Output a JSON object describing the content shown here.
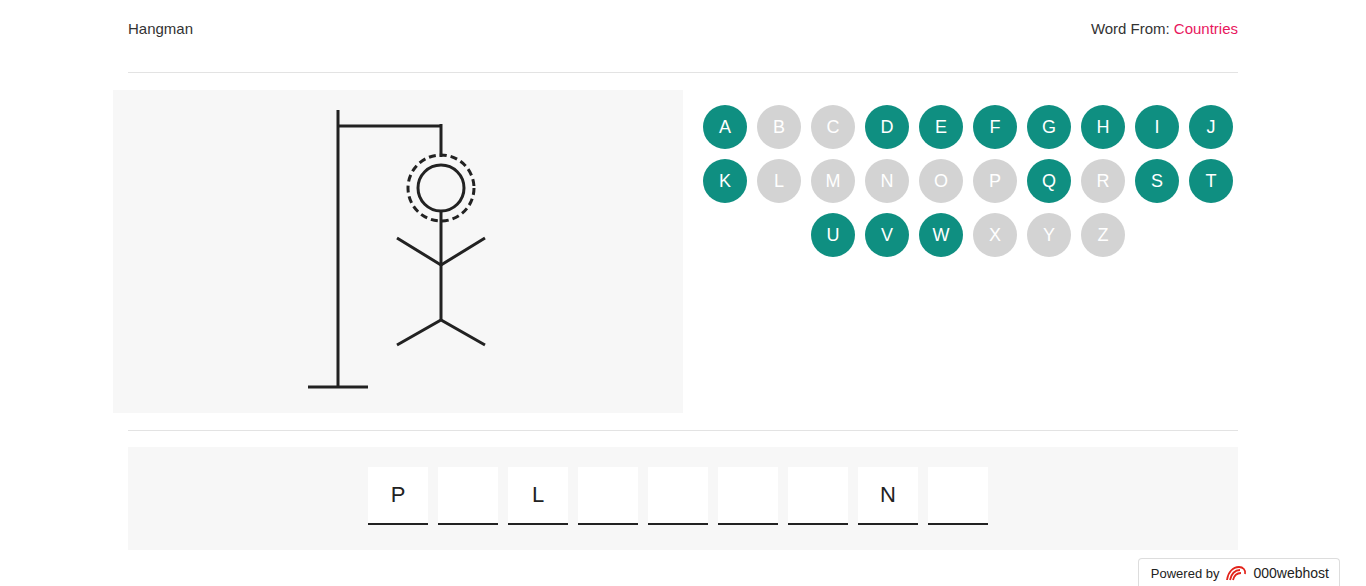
{
  "header": {
    "title": "Hangman",
    "category_label": "Word From:",
    "category": "Countries"
  },
  "hangman": {
    "parts_drawn": 9,
    "parts_total": 9
  },
  "letters": [
    {
      "letter": "A",
      "used": false
    },
    {
      "letter": "B",
      "used": true
    },
    {
      "letter": "C",
      "used": true
    },
    {
      "letter": "D",
      "used": false
    },
    {
      "letter": "E",
      "used": false
    },
    {
      "letter": "F",
      "used": false
    },
    {
      "letter": "G",
      "used": false
    },
    {
      "letter": "H",
      "used": false
    },
    {
      "letter": "I",
      "used": false
    },
    {
      "letter": "J",
      "used": false
    },
    {
      "letter": "K",
      "used": false
    },
    {
      "letter": "L",
      "used": true
    },
    {
      "letter": "M",
      "used": true
    },
    {
      "letter": "N",
      "used": true
    },
    {
      "letter": "O",
      "used": true
    },
    {
      "letter": "P",
      "used": true
    },
    {
      "letter": "Q",
      "used": false
    },
    {
      "letter": "R",
      "used": true
    },
    {
      "letter": "S",
      "used": false
    },
    {
      "letter": "T",
      "used": false
    },
    {
      "letter": "U",
      "used": false
    },
    {
      "letter": "V",
      "used": false
    },
    {
      "letter": "W",
      "used": false
    },
    {
      "letter": "X",
      "used": true
    },
    {
      "letter": "Y",
      "used": true
    },
    {
      "letter": "Z",
      "used": true
    }
  ],
  "word": [
    "P",
    "",
    "L",
    "",
    "",
    "",
    "",
    "N",
    ""
  ],
  "footer": {
    "powered_by": "Powered by",
    "brand": "000webhost"
  }
}
